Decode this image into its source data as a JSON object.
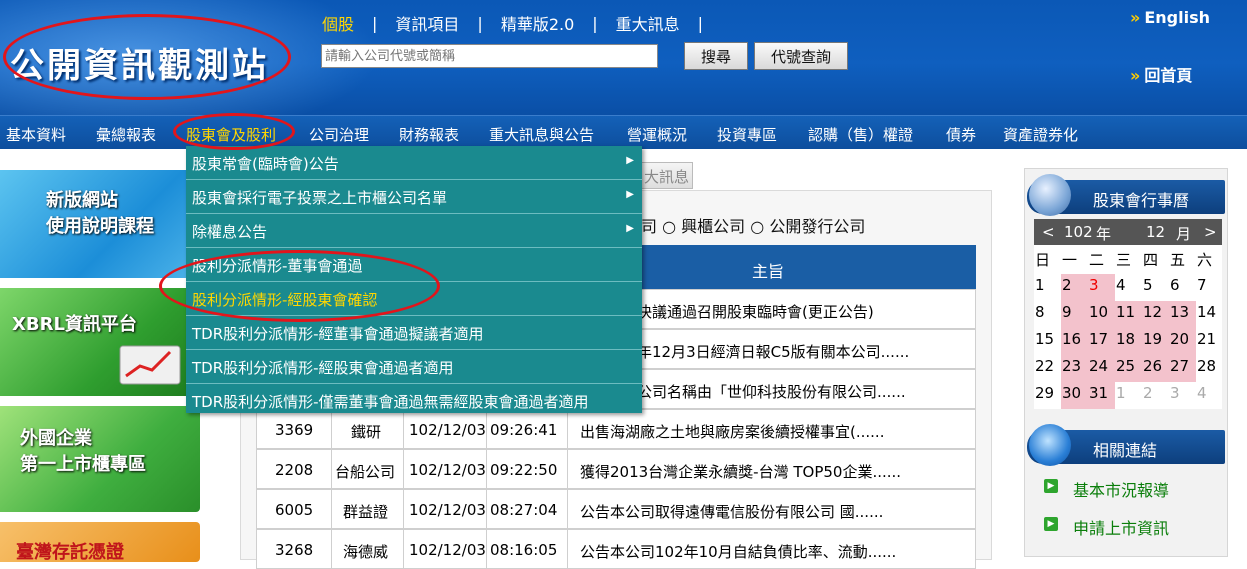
{
  "header": {
    "logo_text": "公開資訊觀測站",
    "top_nav": [
      "個股",
      "資訊項目",
      "精華版2.0",
      "重大訊息"
    ],
    "search_placeholder": "請輸入公司代號或簡稱",
    "search_button": "搜尋",
    "code_button": "代號查詢",
    "english": "English",
    "home": "回首頁"
  },
  "main_nav": [
    "基本資料",
    "彙總報表",
    "股東會及股利",
    "公司治理",
    "財務報表",
    "重大訊息與公告",
    "營運概況",
    "投資專區",
    "認購（售）權證",
    "債券",
    "資產證券化"
  ],
  "dropdown": [
    {
      "label": "股東常會(臨時會)公告",
      "arrow": "▶"
    },
    {
      "label": "股東會採行電子投票之上市櫃公司名單",
      "arrow": "▶"
    },
    {
      "label": "除權息公告",
      "arrow": "▶"
    },
    {
      "label": "股利分派情形-董事會通過",
      "arrow": ""
    },
    {
      "label": "股利分派情形-經股東會確認",
      "arrow": ""
    },
    {
      "label": "TDR股利分派情形-經董事會通過擬議者適用",
      "arrow": ""
    },
    {
      "label": "TDR股利分派情形-經股東會通過者適用",
      "arrow": ""
    },
    {
      "label": "TDR股利分派情形-僅需董事會通過無需經股東會通過者適用",
      "arrow": ""
    }
  ],
  "banners": {
    "new_site_1": "新版網站",
    "new_site_2": "使用說明課程",
    "xbrl": "XBRL資訊平台",
    "foreign_1": "外國企業",
    "foreign_2": "第一上市櫃專區",
    "bottom": "臺灣存託憑證"
  },
  "tab_fragment": "大訊息",
  "radio_fragment": "司",
  "radios": [
    "興櫃公司",
    "公開發行公司"
  ],
  "table": {
    "header": "主旨",
    "partial_rows": [
      "決議通過召開股東臨時會(更正公告)",
      "年12月3日經濟日報C5版有關本公司......",
      "公司名稱由「世仰科技股份有限公司......"
    ],
    "rows": [
      {
        "code": "3369",
        "name": "鐵研",
        "date": "102/12/03",
        "time": "09:26:41",
        "subject": "出售海湖廠之土地與廠房案後續授權事宜(......"
      },
      {
        "code": "2208",
        "name": "台船公司",
        "date": "102/12/03",
        "time": "09:22:50",
        "subject": "獲得2013台灣企業永續獎-台灣 TOP50企業......"
      },
      {
        "code": "6005",
        "name": "群益證",
        "date": "102/12/03",
        "time": "08:27:04",
        "subject": "公告本公司取得遠傳電信股份有限公司 國......"
      },
      {
        "code": "3268",
        "name": "海德威",
        "date": "102/12/03",
        "time": "08:16:05",
        "subject": "公告本公司102年10月自結負債比率、流動......"
      }
    ]
  },
  "calendar": {
    "title": "股東會行事曆",
    "prev": "<",
    "next": ">",
    "year": "102",
    "year_unit": "年",
    "month": "12",
    "month_unit": "月",
    "weekdays": [
      "日",
      "一",
      "二",
      "三",
      "四",
      "五",
      "六"
    ],
    "days": [
      "1",
      "2",
      "3",
      "4",
      "5",
      "6",
      "7",
      "8",
      "9",
      "10",
      "11",
      "12",
      "13",
      "14",
      "15",
      "16",
      "17",
      "18",
      "19",
      "20",
      "21",
      "22",
      "23",
      "24",
      "25",
      "26",
      "27",
      "28",
      "29",
      "30",
      "31",
      "1",
      "2",
      "3",
      "4"
    ]
  },
  "related": {
    "title": "相關連結",
    "links": [
      "基本市況報導",
      "申請上市資訊"
    ]
  },
  "colors": {
    "header_blue": "#0f5fbf",
    "nav_active": "#ffd600",
    "dropdown_bg": "#1a8a8f",
    "table_header": "#1a5ea5",
    "calendar_pink": "#f3c2cc",
    "annotation_red": "#e2151b"
  }
}
